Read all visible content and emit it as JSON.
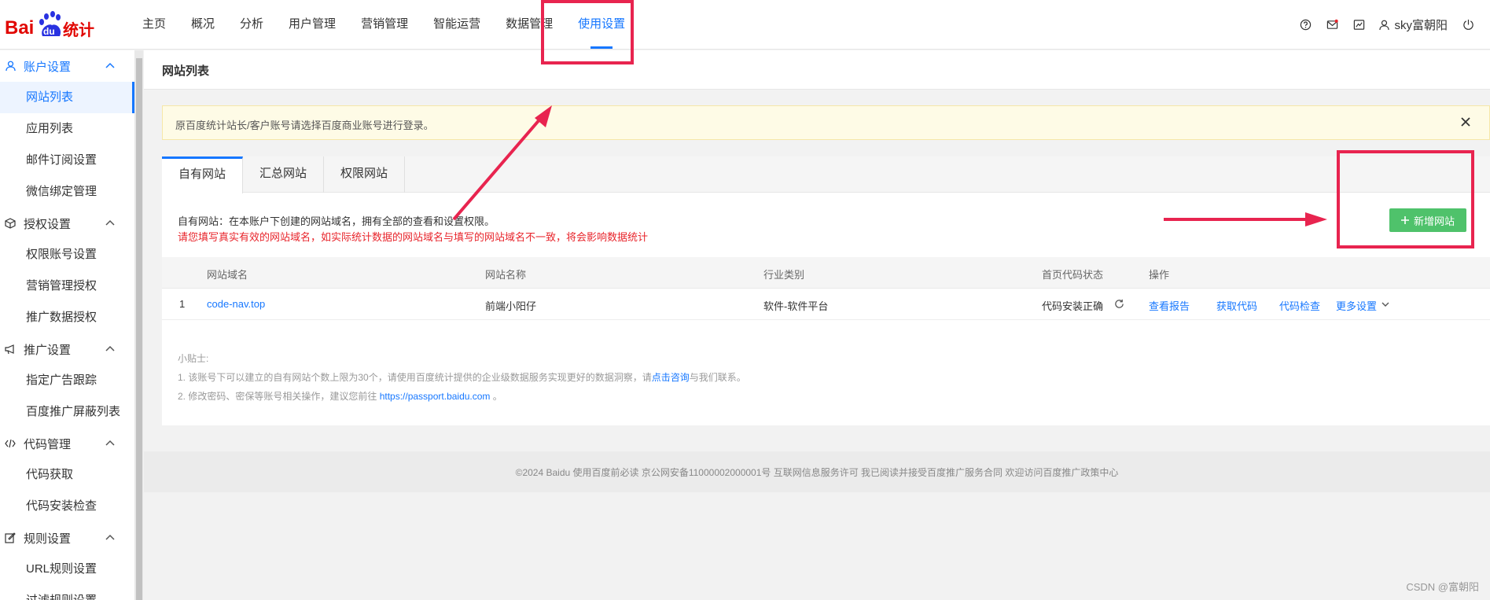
{
  "brand": {
    "logo_left": "Bai",
    "logo_mid": "du",
    "logo_right": "统计"
  },
  "nav": [
    {
      "label": "主页"
    },
    {
      "label": "概况"
    },
    {
      "label": "分析"
    },
    {
      "label": "用户管理"
    },
    {
      "label": "营销管理"
    },
    {
      "label": "智能运营"
    },
    {
      "label": "数据管理"
    },
    {
      "label": "使用设置",
      "active": true
    }
  ],
  "header_user": {
    "name": "sky富朝阳"
  },
  "sidebar": {
    "groups": [
      {
        "label": "账户设置",
        "icon": "user-icon",
        "items": [
          "网站列表",
          "应用列表",
          "邮件订阅设置",
          "微信绑定管理"
        ]
      },
      {
        "label": "授权设置",
        "icon": "cube-icon",
        "items": [
          "权限账号设置",
          "营销管理授权",
          "推广数据授权"
        ]
      },
      {
        "label": "推广设置",
        "icon": "megaphone-icon",
        "items": [
          "指定广告跟踪",
          "百度推广屏蔽列表"
        ]
      },
      {
        "label": "代码管理",
        "icon": "code-icon",
        "items": [
          "代码获取",
          "代码安装检查"
        ]
      },
      {
        "label": "规则设置",
        "icon": "edit-icon",
        "items": [
          "URL规则设置",
          "过滤规则设置"
        ]
      }
    ]
  },
  "page": {
    "title": "网站列表"
  },
  "notice": {
    "text": "原百度统计站长/客户账号请选择百度商业账号进行登录。"
  },
  "tabs": [
    "自有网站",
    "汇总网站",
    "权限网站"
  ],
  "description": {
    "line1": "自有网站：在本账户下创建的网站域名，拥有全部的查看和设置权限。",
    "line2": "请您填写真实有效的网站域名，如实际统计数据的网站域名与填写的网站域名不一致，将会影响数据统计"
  },
  "add_button": {
    "label": "新增网站"
  },
  "table": {
    "columns": [
      "网站域名",
      "网站名称",
      "行业类别",
      "首页代码状态",
      "操作"
    ],
    "rows": [
      {
        "index": "1",
        "domain": "code-nav.top",
        "name": "前端小阳仔",
        "industry": "软件-软件平台",
        "status": "代码安装正确",
        "actions": [
          "查看报告",
          "获取代码",
          "代码检查",
          "更多设置"
        ]
      }
    ]
  },
  "tips": {
    "title": "小贴士:",
    "tip1_prefix": "1. 该账号下可以建立的自有网站个数上限为30个，请使用百度统计提供的企业级数据服务实现更好的数据洞察，请",
    "tip1_link": "点击咨询",
    "tip1_suffix": "与我们联系。",
    "tip2_prefix": "2. 修改密码、密保等账号相关操作，建议您前往 ",
    "tip2_link": "https://passport.baidu.com",
    "tip2_suffix": " 。"
  },
  "footer": {
    "text": "©2024 Baidu 使用百度前必读 京公网安备11000002000001号 互联网信息服务许可 我已阅读并接受百度推广服务合同 欢迎访问百度推广政策中心"
  },
  "watermark": "CSDN @富朝阳",
  "colors": {
    "accent": "#1677ff",
    "add_button": "#4fc26b",
    "warning_text": "#e8242b",
    "annotation": "#e8244f"
  }
}
